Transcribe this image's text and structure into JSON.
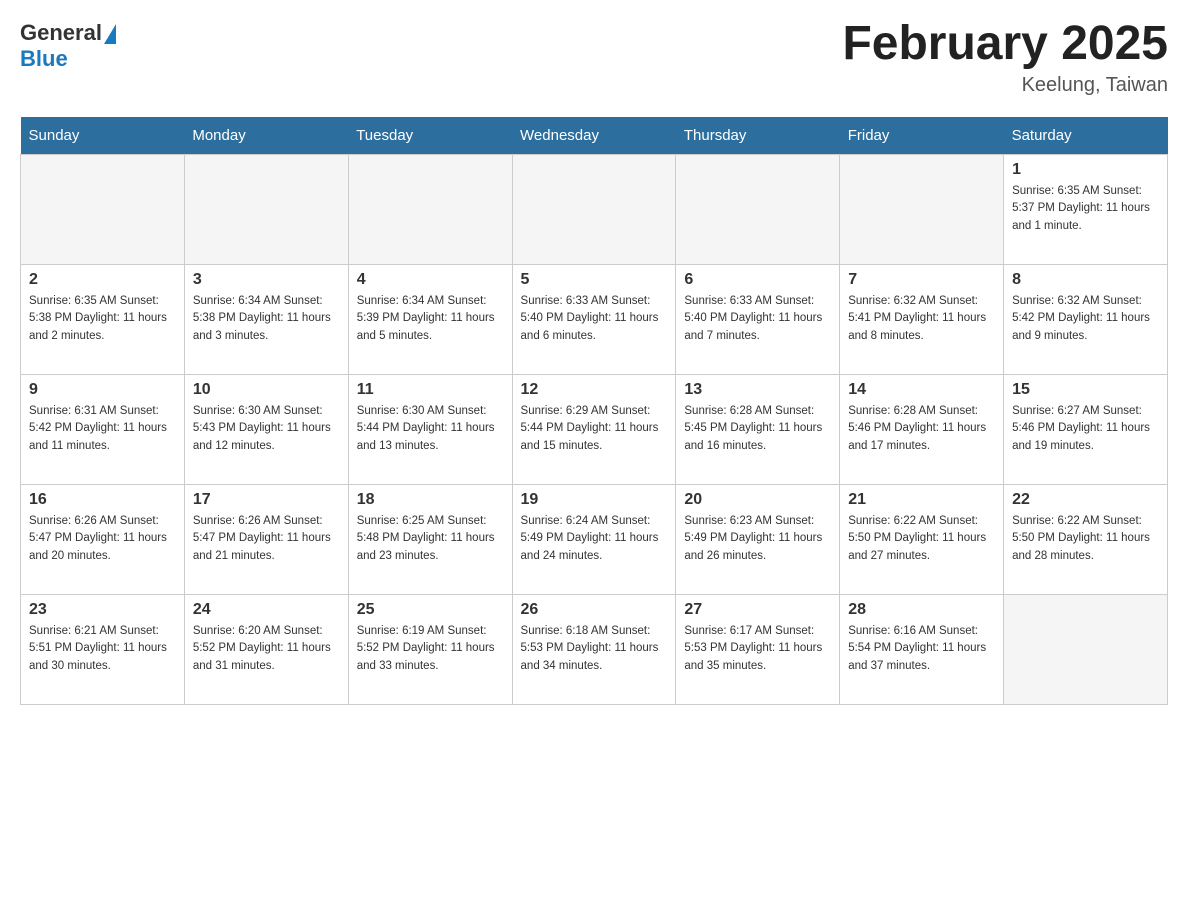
{
  "header": {
    "logo_general": "General",
    "logo_blue": "Blue",
    "month_title": "February 2025",
    "location": "Keelung, Taiwan"
  },
  "days_of_week": [
    "Sunday",
    "Monday",
    "Tuesday",
    "Wednesday",
    "Thursday",
    "Friday",
    "Saturday"
  ],
  "weeks": [
    [
      {
        "day": "",
        "info": ""
      },
      {
        "day": "",
        "info": ""
      },
      {
        "day": "",
        "info": ""
      },
      {
        "day": "",
        "info": ""
      },
      {
        "day": "",
        "info": ""
      },
      {
        "day": "",
        "info": ""
      },
      {
        "day": "1",
        "info": "Sunrise: 6:35 AM\nSunset: 5:37 PM\nDaylight: 11 hours and 1 minute."
      }
    ],
    [
      {
        "day": "2",
        "info": "Sunrise: 6:35 AM\nSunset: 5:38 PM\nDaylight: 11 hours and 2 minutes."
      },
      {
        "day": "3",
        "info": "Sunrise: 6:34 AM\nSunset: 5:38 PM\nDaylight: 11 hours and 3 minutes."
      },
      {
        "day": "4",
        "info": "Sunrise: 6:34 AM\nSunset: 5:39 PM\nDaylight: 11 hours and 5 minutes."
      },
      {
        "day": "5",
        "info": "Sunrise: 6:33 AM\nSunset: 5:40 PM\nDaylight: 11 hours and 6 minutes."
      },
      {
        "day": "6",
        "info": "Sunrise: 6:33 AM\nSunset: 5:40 PM\nDaylight: 11 hours and 7 minutes."
      },
      {
        "day": "7",
        "info": "Sunrise: 6:32 AM\nSunset: 5:41 PM\nDaylight: 11 hours and 8 minutes."
      },
      {
        "day": "8",
        "info": "Sunrise: 6:32 AM\nSunset: 5:42 PM\nDaylight: 11 hours and 9 minutes."
      }
    ],
    [
      {
        "day": "9",
        "info": "Sunrise: 6:31 AM\nSunset: 5:42 PM\nDaylight: 11 hours and 11 minutes."
      },
      {
        "day": "10",
        "info": "Sunrise: 6:30 AM\nSunset: 5:43 PM\nDaylight: 11 hours and 12 minutes."
      },
      {
        "day": "11",
        "info": "Sunrise: 6:30 AM\nSunset: 5:44 PM\nDaylight: 11 hours and 13 minutes."
      },
      {
        "day": "12",
        "info": "Sunrise: 6:29 AM\nSunset: 5:44 PM\nDaylight: 11 hours and 15 minutes."
      },
      {
        "day": "13",
        "info": "Sunrise: 6:28 AM\nSunset: 5:45 PM\nDaylight: 11 hours and 16 minutes."
      },
      {
        "day": "14",
        "info": "Sunrise: 6:28 AM\nSunset: 5:46 PM\nDaylight: 11 hours and 17 minutes."
      },
      {
        "day": "15",
        "info": "Sunrise: 6:27 AM\nSunset: 5:46 PM\nDaylight: 11 hours and 19 minutes."
      }
    ],
    [
      {
        "day": "16",
        "info": "Sunrise: 6:26 AM\nSunset: 5:47 PM\nDaylight: 11 hours and 20 minutes."
      },
      {
        "day": "17",
        "info": "Sunrise: 6:26 AM\nSunset: 5:47 PM\nDaylight: 11 hours and 21 minutes."
      },
      {
        "day": "18",
        "info": "Sunrise: 6:25 AM\nSunset: 5:48 PM\nDaylight: 11 hours and 23 minutes."
      },
      {
        "day": "19",
        "info": "Sunrise: 6:24 AM\nSunset: 5:49 PM\nDaylight: 11 hours and 24 minutes."
      },
      {
        "day": "20",
        "info": "Sunrise: 6:23 AM\nSunset: 5:49 PM\nDaylight: 11 hours and 26 minutes."
      },
      {
        "day": "21",
        "info": "Sunrise: 6:22 AM\nSunset: 5:50 PM\nDaylight: 11 hours and 27 minutes."
      },
      {
        "day": "22",
        "info": "Sunrise: 6:22 AM\nSunset: 5:50 PM\nDaylight: 11 hours and 28 minutes."
      }
    ],
    [
      {
        "day": "23",
        "info": "Sunrise: 6:21 AM\nSunset: 5:51 PM\nDaylight: 11 hours and 30 minutes."
      },
      {
        "day": "24",
        "info": "Sunrise: 6:20 AM\nSunset: 5:52 PM\nDaylight: 11 hours and 31 minutes."
      },
      {
        "day": "25",
        "info": "Sunrise: 6:19 AM\nSunset: 5:52 PM\nDaylight: 11 hours and 33 minutes."
      },
      {
        "day": "26",
        "info": "Sunrise: 6:18 AM\nSunset: 5:53 PM\nDaylight: 11 hours and 34 minutes."
      },
      {
        "day": "27",
        "info": "Sunrise: 6:17 AM\nSunset: 5:53 PM\nDaylight: 11 hours and 35 minutes."
      },
      {
        "day": "28",
        "info": "Sunrise: 6:16 AM\nSunset: 5:54 PM\nDaylight: 11 hours and 37 minutes."
      },
      {
        "day": "",
        "info": ""
      }
    ]
  ]
}
